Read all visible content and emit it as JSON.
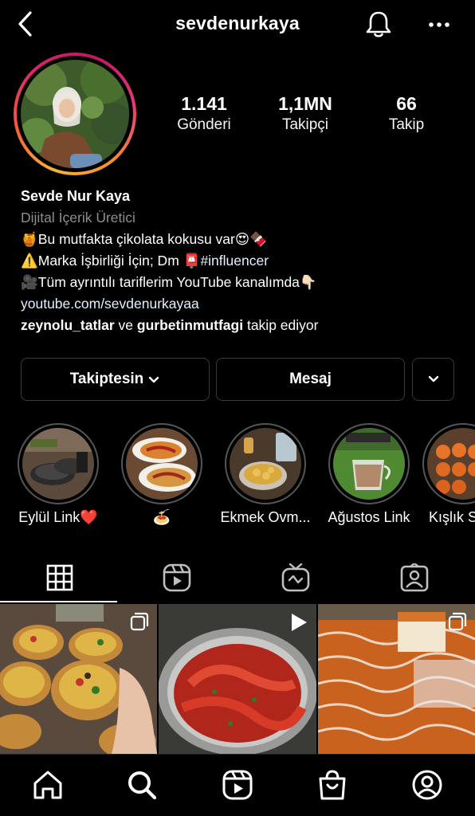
{
  "header": {
    "username": "sevdenurkaya"
  },
  "stats": [
    {
      "num": "1.141",
      "label": "Gönderi"
    },
    {
      "num": "1,1MN",
      "label": "Takipçi"
    },
    {
      "num": "66",
      "label": "Takip"
    }
  ],
  "bio": {
    "name": "Sevde Nur Kaya",
    "category": "Dijital İçerik Üretici",
    "line1_icon": "🍯",
    "line1": "Bu mutfakta çikolata kokusu var",
    "line1_emoji": "😍🍫",
    "line2_icon": "⚠️",
    "line2": "Marka İşbirliği İçin; Dm ",
    "line2_emoji": "📮",
    "line2_tag": "#influencer",
    "line3_icon": "🎥",
    "line3": "Tüm ayrıntılı tariflerim YouTube kanalımda",
    "line3_emoji": "👇🏻",
    "link": "youtube.com/sevdenurkayaa",
    "followed_by_1": "zeynolu_tatlar",
    "followed_by_and": " ve ",
    "followed_by_2": "gurbetinmutfagi",
    "followed_by_suffix": " takip ediyor"
  },
  "buttons": {
    "following": "Takiptesin",
    "message": "Mesaj"
  },
  "highlights": [
    {
      "label": "Eylül Link❤️"
    },
    {
      "label": "🍝"
    },
    {
      "label": "Ekmek Ovm..."
    },
    {
      "label": "Ağustos Link"
    },
    {
      "label": "Kışlık S"
    }
  ],
  "colors": {
    "background": "#000000",
    "secondary_text": "#8e8e8e",
    "link_text": "#e0f1ff",
    "button_border": "#3a3a3a"
  }
}
